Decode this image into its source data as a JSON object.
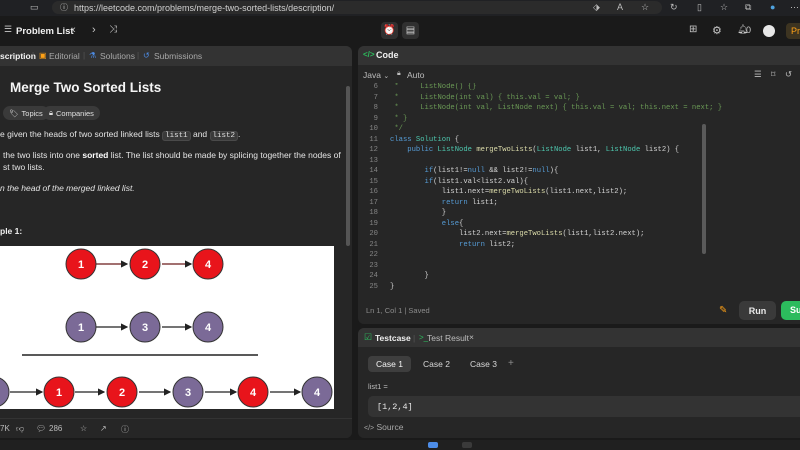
{
  "browser": {
    "url": "https://leetcode.com/problems/merge-two-sorted-lists/description/",
    "icons": [
      "tab-icon",
      "info-icon",
      "bookmark-icon",
      "read-aloud-icon",
      "favorites-icon",
      "refresh-icon",
      "split-screen-icon",
      "collections-icon",
      "copilot-icon",
      "more-icon"
    ]
  },
  "header": {
    "problem_list_label": "Problem List",
    "streak_count": "0",
    "premium_label": "Pr"
  },
  "left_tabs": [
    {
      "label": "scription",
      "active": true
    },
    {
      "label": "Editorial",
      "active": false
    },
    {
      "label": "Solutions",
      "active": false
    },
    {
      "label": "Submissions",
      "active": false
    }
  ],
  "problem": {
    "title": "Merge Two Sorted Lists",
    "chips": [
      "Topics",
      "Companies"
    ],
    "desc1_pre": "e given the heads of two sorted linked lists",
    "code_list1": "list1",
    "desc1_and": "and",
    "code_list2": "list2",
    "desc1_post": ".",
    "desc2_pre": "the two lists into one",
    "desc2_bold": "sorted",
    "desc2_post": "list. The list should be made by splicing together the nodes of",
    "desc3": "st two lists.",
    "desc4": "n the head of the merged linked list.",
    "example_title": "ple 1:"
  },
  "diagram": {
    "row1": [
      "1",
      "2",
      "4"
    ],
    "row2": [
      "1",
      "3",
      "4"
    ],
    "row3": [
      "",
      "1",
      "2",
      "3",
      "4",
      "4"
    ],
    "colors": {
      "red": "#e8141b",
      "purple": "#7b6a97"
    }
  },
  "left_footer": {
    "likes": "7K",
    "comments": "286"
  },
  "code": {
    "title": "Code",
    "language": "Java",
    "mode": "Auto",
    "lines": [
      {
        "n": "6",
        "t": " *     ListNode() {}",
        "c": "cm"
      },
      {
        "n": "7",
        "t": " *     ListNode(int val) { this.val = val; }",
        "c": "cm"
      },
      {
        "n": "8",
        "t": " *     ListNode(int val, ListNode next) { this.val = val; this.next = next; }",
        "c": "cm"
      },
      {
        "n": "9",
        "t": " * }",
        "c": "cm"
      },
      {
        "n": "10",
        "t": " */",
        "c": "cm"
      },
      {
        "n": "11",
        "t": "class Solution {",
        "c": "tx"
      },
      {
        "n": "12",
        "t": "    public ListNode mergeTwoLists(ListNode list1, ListNode list2) {",
        "c": "tx"
      },
      {
        "n": "13",
        "t": "",
        "c": "tx"
      },
      {
        "n": "14",
        "t": "        if(list1!=null && list2!=null){",
        "c": "tx"
      },
      {
        "n": "15",
        "t": "        if(list1.val<list2.val){",
        "c": "tx"
      },
      {
        "n": "16",
        "t": "            list1.next=mergeTwoLists(list1.next,list2);",
        "c": "tx"
      },
      {
        "n": "17",
        "t": "            return list1;",
        "c": "tx"
      },
      {
        "n": "18",
        "t": "            }",
        "c": "tx"
      },
      {
        "n": "19",
        "t": "            else{",
        "c": "tx"
      },
      {
        "n": "20",
        "t": "                list2.next=mergeTwoLists(list1,list2.next);",
        "c": "tx"
      },
      {
        "n": "21",
        "t": "                return list2;",
        "c": "tx"
      },
      {
        "n": "22",
        "t": "",
        "c": "tx"
      },
      {
        "n": "23",
        "t": "",
        "c": "tx"
      },
      {
        "n": "24",
        "t": "        }",
        "c": "tx"
      },
      {
        "n": "25",
        "t": "}",
        "c": "tx"
      }
    ],
    "status": "Ln 1, Col 1  |  Saved",
    "run_label": "Run",
    "submit_label": "Su"
  },
  "testcase": {
    "tab_label": "Testcase",
    "result_label": "Test Result",
    "cases": [
      "Case 1",
      "Case 2",
      "Case 3"
    ],
    "add_label": "+",
    "param_label": "list1 =",
    "param_value": "[1,2,4]",
    "source_label": "Source"
  },
  "colors": {
    "accent_green": "#2cbb5d",
    "accent_orange": "#ffa116",
    "panel_bg": "#262626",
    "page_bg": "#1a1a1a"
  }
}
